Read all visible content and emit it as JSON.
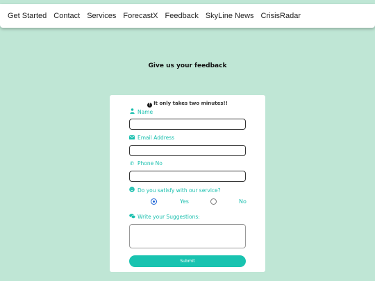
{
  "nav": {
    "items": [
      "Get Started",
      "Contact",
      "Services",
      "ForecastX",
      "Feedback",
      "SkyLine News",
      "CrisisRadar"
    ]
  },
  "page": {
    "title": "Give us your feedback"
  },
  "form": {
    "note": "It only takes two minutes!!",
    "name_label": "Name",
    "email_label": "Email Address",
    "phone_label": "Phone No",
    "satisfy_label": "Do you satisfy with our service?",
    "yes_label": "Yes",
    "no_label": "No",
    "selected_option": "Yes",
    "suggestions_label": "Write your Suggestions:",
    "submit_label": "Submit",
    "name_value": "",
    "email_value": "",
    "phone_value": "",
    "suggestions_value": ""
  },
  "icons": {
    "note": "exclamation-circle-icon",
    "name": "user-icon",
    "email": "envelope-icon",
    "phone": "phone-icon",
    "satisfy": "smile-icon",
    "suggestions": "comments-icon"
  },
  "colors": {
    "background": "#bfe6d5",
    "accent": "#19bfae",
    "submit": "#19c3b0",
    "radio_checked": "#1a62d6"
  }
}
